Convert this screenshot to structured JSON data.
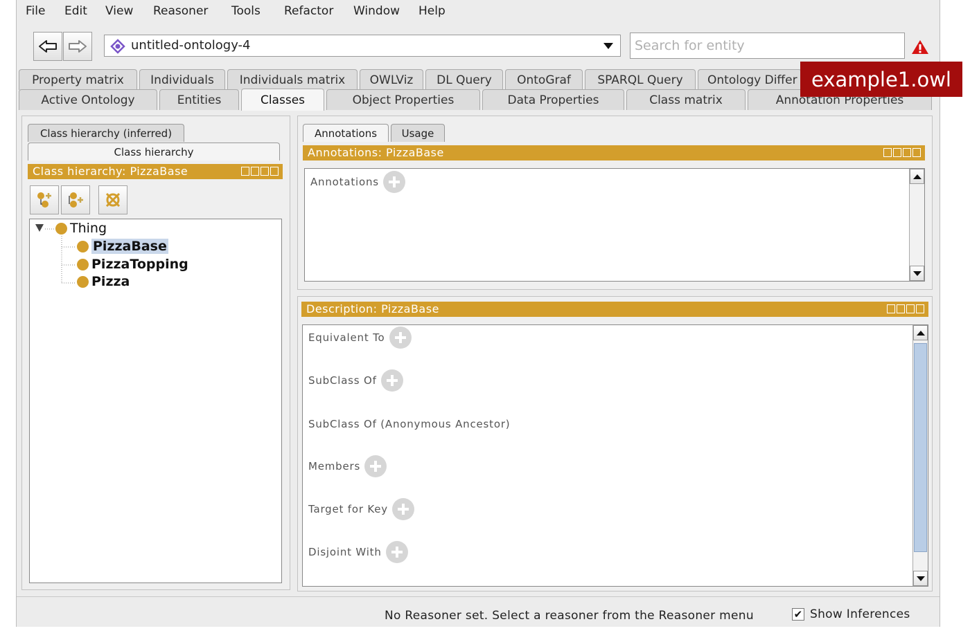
{
  "menu": [
    "File",
    "Edit",
    "View",
    "Reasoner",
    "Tools",
    "Refactor",
    "Window",
    "Help"
  ],
  "toolbar": {
    "back_icon": "arrow-left-icon",
    "forward_icon": "arrow-right-icon",
    "ontology": "untitled-ontology-4",
    "search_placeholder": "Search for entity",
    "warning_icon": "warning-icon"
  },
  "tabs_row1": [
    "Property matrix",
    "Individuals",
    "Individuals matrix",
    "OWLViz",
    "DL Query",
    "OntoGraf",
    "SPARQL Query",
    "Ontology Differ"
  ],
  "tabs_row2": [
    "Active Ontology",
    "Entities",
    "Classes",
    "Object Properties",
    "Data Properties",
    "Class matrix",
    "Annotation Properties"
  ],
  "active_tab": "Classes",
  "overlay_badge": "example1.owl",
  "class_hierarchy": {
    "tab_inferred": "Class hierarchy (inferred)",
    "tab_asserted": "Class hierarchy",
    "header": "Class hierarchy: PizzaBase",
    "tools": [
      "add-subclass-icon",
      "add-sibling-icon",
      "delete-class-icon"
    ],
    "tree": {
      "root": "Thing",
      "children": [
        "PizzaBase",
        "PizzaTopping",
        "Pizza"
      ],
      "selected": "PizzaBase"
    }
  },
  "annotations": {
    "tab_annotations": "Annotations",
    "tab_usage": "Usage",
    "header": "Annotations: PizzaBase",
    "label": "Annotations"
  },
  "description": {
    "header": "Description: PizzaBase",
    "sections": [
      "Equivalent To",
      "SubClass Of",
      "SubClass Of (Anonymous Ancestor)",
      "Members",
      "Target for Key",
      "Disjoint With"
    ]
  },
  "status": {
    "message": "No Reasoner set. Select a reasoner from the Reasoner menu",
    "show_inferences_label": "Show Inferences",
    "show_inferences_checked": "✔"
  },
  "colors": {
    "header": "#d39e2c",
    "badge": "#a30d0d",
    "selection": "#c9d7ea"
  }
}
